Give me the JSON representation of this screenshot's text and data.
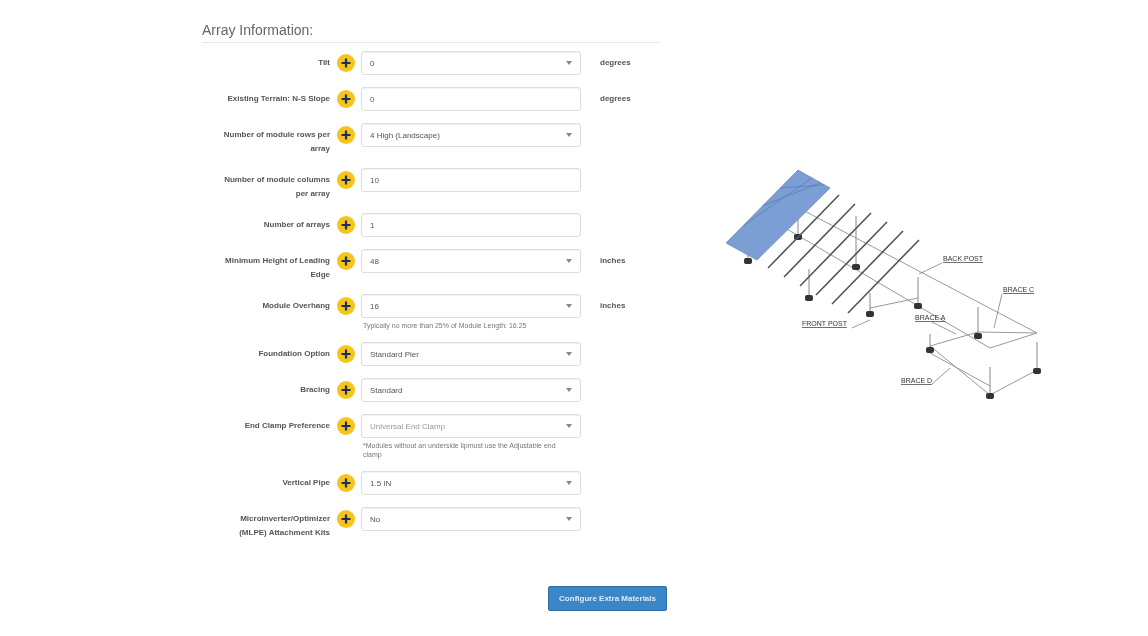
{
  "heading": "Array Information:",
  "fields": [
    {
      "label": "Tilt",
      "kind": "select",
      "value": "0",
      "unit": "degrees",
      "disabled": false
    },
    {
      "label": "Existing Terrain: N-S Slope",
      "kind": "input",
      "value": "0",
      "unit": "degrees",
      "disabled": false
    },
    {
      "label": "Number of module rows per array",
      "kind": "select",
      "value": "4 High (Landscape)",
      "disabled": false
    },
    {
      "label": "Number of module columns per array",
      "kind": "input",
      "value": "10",
      "disabled": false
    },
    {
      "label": "Number of arrays",
      "kind": "input",
      "value": "1",
      "disabled": false
    },
    {
      "label": "Minimum Height of Leading Edge",
      "kind": "select",
      "value": "48",
      "unit": "inches",
      "disabled": false
    },
    {
      "label": "Module Overhang",
      "kind": "select",
      "value": "16",
      "unit": "inches",
      "help": "Typically no more than 25% of Module Length: 16.25",
      "disabled": false
    },
    {
      "label": "Foundation Option",
      "kind": "select",
      "value": "Standard Pier",
      "disabled": false
    },
    {
      "label": "Bracing",
      "kind": "select",
      "value": "Standard",
      "disabled": false
    },
    {
      "label": "End Clamp Preference",
      "kind": "select",
      "value": "Universal End Clamp",
      "help": "*Modules without an underside lipmust use the Adjustable end clamp",
      "disabled": true
    },
    {
      "label": "Vertical Pipe",
      "kind": "select",
      "value": "1.5 IN",
      "disabled": false
    },
    {
      "label": "Microinverter/Optimizer (MLPE) Attachment Kits",
      "kind": "select",
      "value": "No",
      "disabled": false
    }
  ],
  "diagram": {
    "callouts": [
      "BACK POST",
      "BRACE C",
      "BRACE A",
      "FRONT POST",
      "BRACE D"
    ]
  },
  "button": "Configure Extra Materials"
}
